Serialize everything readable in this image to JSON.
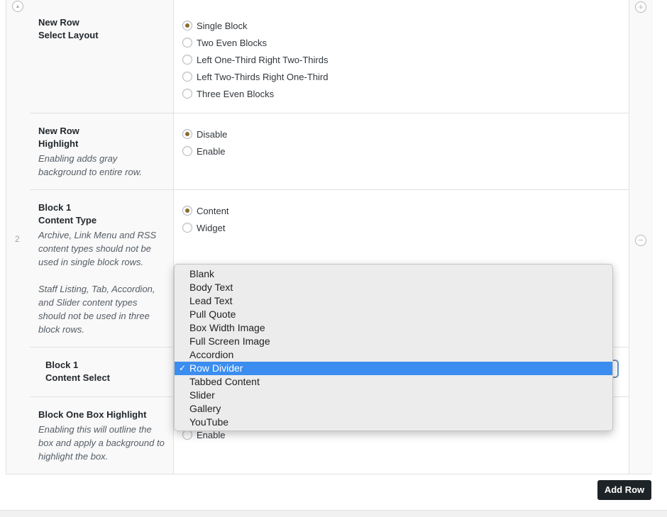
{
  "row_number": "2",
  "controls": {
    "move_up": "▲",
    "add": "+",
    "remove": "−"
  },
  "layout": {
    "title1": "New Row",
    "title2": "Select Layout",
    "options": [
      "Single Block",
      "Two Even Blocks",
      "Left One-Third Right Two-Thirds",
      "Left Two-Thirds Right One-Third",
      "Three Even Blocks"
    ],
    "selected": "Single Block"
  },
  "highlight": {
    "title1": "New Row",
    "title2": "Highlight",
    "desc": "Enabling adds gray background to entire row.",
    "options": [
      "Disable",
      "Enable"
    ],
    "selected": "Disable"
  },
  "content_type": {
    "title1": "Block 1",
    "title2": "Content Type",
    "desc1": "Archive, Link Menu and RSS content types should not be used in single block rows.",
    "desc2": "Staff Listing, Tab, Accordion, and Slider content types should not be used in three block rows.",
    "options": [
      "Content",
      "Widget"
    ],
    "selected": "Content"
  },
  "content_select": {
    "title1": "Block 1",
    "title2": "Content Select",
    "options": [
      "Blank",
      "Body Text",
      "Lead Text",
      "Pull Quote",
      "Box Width Image",
      "Full Screen Image",
      "Accordion",
      "Row Divider",
      "Tabbed Content",
      "Slider",
      "Gallery",
      "YouTube"
    ],
    "selected": "Row Divider"
  },
  "box_highlight": {
    "title": "Block One Box Highlight",
    "desc": "Enabling this will outline the box and apply a background to highlight the box.",
    "visible_option": "Enable"
  },
  "add_row_label": "Add Row"
}
